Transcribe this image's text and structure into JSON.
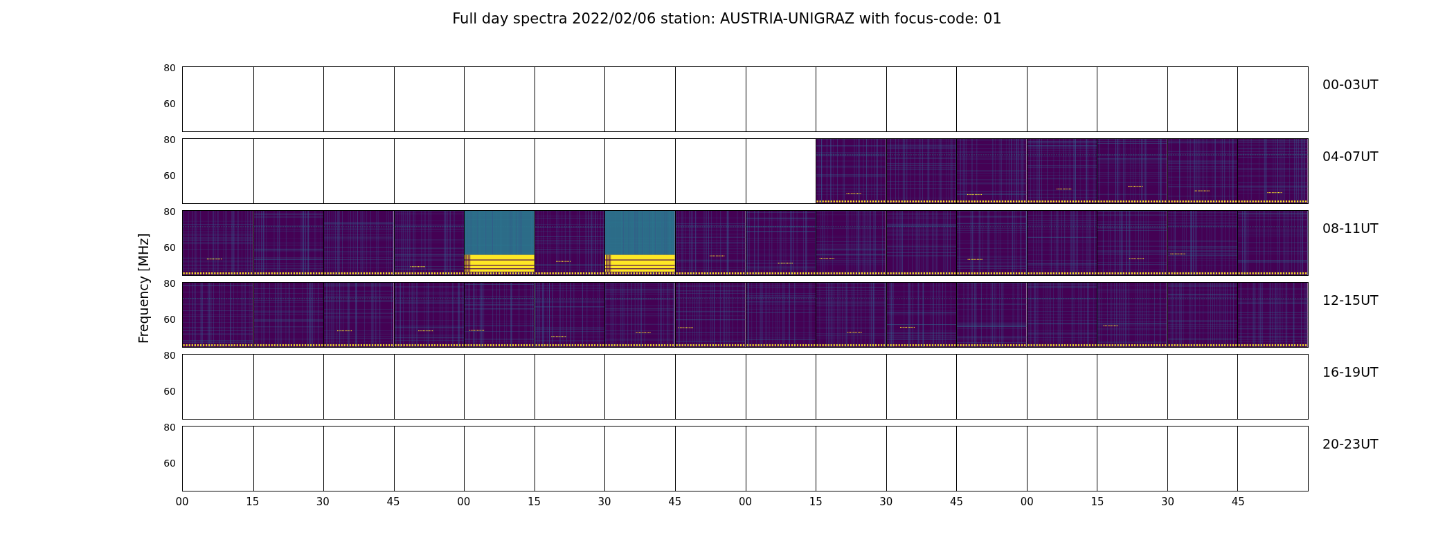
{
  "title": "Full day spectra 2022/02/06 station: AUSTRIA-UNIGRAZ with focus-code: 01",
  "ylabel": "Frequency [MHz]",
  "rows": [
    {
      "label": "00-03UT",
      "yticks": [
        "80",
        "60"
      ],
      "panels": [
        {
          "kind": "empty"
        },
        {
          "kind": "empty"
        },
        {
          "kind": "empty"
        },
        {
          "kind": "empty"
        },
        {
          "kind": "empty"
        },
        {
          "kind": "empty"
        },
        {
          "kind": "empty"
        },
        {
          "kind": "empty"
        },
        {
          "kind": "empty"
        },
        {
          "kind": "empty"
        },
        {
          "kind": "empty"
        },
        {
          "kind": "empty"
        },
        {
          "kind": "empty"
        },
        {
          "kind": "empty"
        },
        {
          "kind": "empty"
        },
        {
          "kind": "empty"
        }
      ]
    },
    {
      "label": "04-07UT",
      "yticks": [
        "80",
        "60"
      ],
      "panels": [
        {
          "kind": "empty"
        },
        {
          "kind": "empty"
        },
        {
          "kind": "empty"
        },
        {
          "kind": "empty"
        },
        {
          "kind": "empty"
        },
        {
          "kind": "empty"
        },
        {
          "kind": "empty"
        },
        {
          "kind": "empty"
        },
        {
          "kind": "empty"
        },
        {
          "kind": "spectrogram"
        },
        {
          "kind": "spectrogram"
        },
        {
          "kind": "spectrogram"
        },
        {
          "kind": "spectrogram"
        },
        {
          "kind": "spectrogram"
        },
        {
          "kind": "spectrogram"
        },
        {
          "kind": "spectrogram"
        }
      ]
    },
    {
      "label": "08-11UT",
      "yticks": [
        "80",
        "60"
      ],
      "panels": [
        {
          "kind": "spectrogram"
        },
        {
          "kind": "spectrogram"
        },
        {
          "kind": "spectrogram"
        },
        {
          "kind": "spectrogram"
        },
        {
          "kind": "saturated"
        },
        {
          "kind": "spectrogram"
        },
        {
          "kind": "saturated"
        },
        {
          "kind": "spectrogram"
        },
        {
          "kind": "spectrogram"
        },
        {
          "kind": "spectrogram"
        },
        {
          "kind": "spectrogram"
        },
        {
          "kind": "spectrogram"
        },
        {
          "kind": "spectrogram"
        },
        {
          "kind": "spectrogram"
        },
        {
          "kind": "spectrogram"
        },
        {
          "kind": "spectrogram"
        }
      ]
    },
    {
      "label": "12-15UT",
      "yticks": [
        "80",
        "60"
      ],
      "panels": [
        {
          "kind": "spectrogram"
        },
        {
          "kind": "spectrogram"
        },
        {
          "kind": "spectrogram"
        },
        {
          "kind": "spectrogram"
        },
        {
          "kind": "spectrogram"
        },
        {
          "kind": "spectrogram"
        },
        {
          "kind": "spectrogram"
        },
        {
          "kind": "spectrogram"
        },
        {
          "kind": "spectrogram"
        },
        {
          "kind": "spectrogram"
        },
        {
          "kind": "spectrogram"
        },
        {
          "kind": "spectrogram"
        },
        {
          "kind": "spectrogram"
        },
        {
          "kind": "spectrogram"
        },
        {
          "kind": "spectrogram"
        },
        {
          "kind": "spectrogram"
        }
      ]
    },
    {
      "label": "16-19UT",
      "yticks": [
        "80",
        "60"
      ],
      "panels": [
        {
          "kind": "empty"
        },
        {
          "kind": "empty"
        },
        {
          "kind": "empty"
        },
        {
          "kind": "empty"
        },
        {
          "kind": "empty"
        },
        {
          "kind": "empty"
        },
        {
          "kind": "empty"
        },
        {
          "kind": "empty"
        },
        {
          "kind": "empty"
        },
        {
          "kind": "empty"
        },
        {
          "kind": "empty"
        },
        {
          "kind": "empty"
        },
        {
          "kind": "empty"
        },
        {
          "kind": "empty"
        },
        {
          "kind": "empty"
        },
        {
          "kind": "empty"
        }
      ]
    },
    {
      "label": "20-23UT",
      "yticks": [
        "80",
        "60"
      ],
      "panels": [
        {
          "kind": "empty"
        },
        {
          "kind": "empty"
        },
        {
          "kind": "empty"
        },
        {
          "kind": "empty"
        },
        {
          "kind": "empty"
        },
        {
          "kind": "empty"
        },
        {
          "kind": "empty"
        },
        {
          "kind": "empty"
        },
        {
          "kind": "empty"
        },
        {
          "kind": "empty"
        },
        {
          "kind": "empty"
        },
        {
          "kind": "empty"
        },
        {
          "kind": "empty"
        },
        {
          "kind": "empty"
        },
        {
          "kind": "empty"
        },
        {
          "kind": "empty"
        }
      ]
    }
  ],
  "xticks": [
    "00",
    "15",
    "30",
    "45",
    "00",
    "15",
    "30",
    "45",
    "00",
    "15",
    "30",
    "45",
    "00",
    "15",
    "30",
    "45"
  ]
}
